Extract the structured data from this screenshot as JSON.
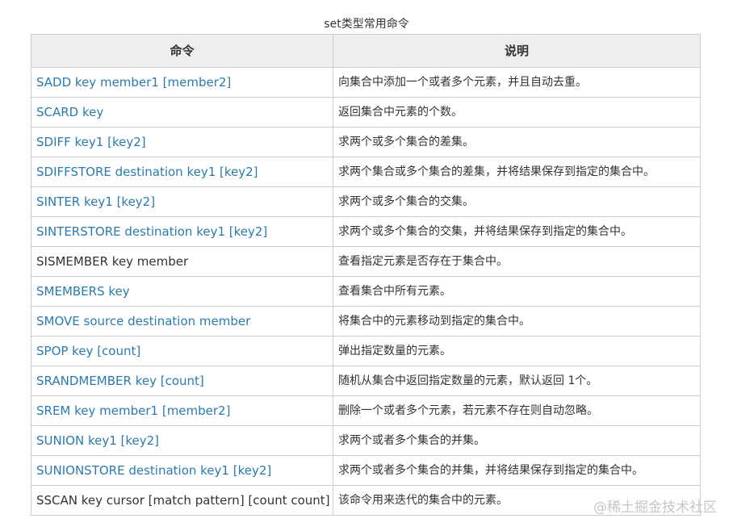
{
  "caption": "set类型常用命令",
  "table": {
    "headers": [
      "命令",
      "说明"
    ],
    "rows": [
      {
        "command": "SADD key member1 [member2]",
        "description": "向集合中添加一个或者多个元素，并且自动去重。",
        "linked": true
      },
      {
        "command": "SCARD key",
        "description": "返回集合中元素的个数。",
        "linked": true
      },
      {
        "command": "SDIFF key1 [key2]",
        "description": "求两个或多个集合的差集。",
        "linked": true
      },
      {
        "command": "SDIFFSTORE destination key1 [key2]",
        "description": "求两个集合或多个集合的差集，并将结果保存到指定的集合中。",
        "linked": true
      },
      {
        "command": "SINTER key1 [key2]",
        "description": "求两个或多个集合的交集。",
        "linked": true
      },
      {
        "command": "SINTERSTORE destination key1 [key2]",
        "description": "求两个或多个集合的交集，并将结果保存到指定的集合中。",
        "linked": true
      },
      {
        "command": "SISMEMBER key member",
        "description": "查看指定元素是否存在于集合中。",
        "linked": false
      },
      {
        "command": "SMEMBERS key",
        "description": "查看集合中所有元素。",
        "linked": true
      },
      {
        "command": "SMOVE source destination member",
        "description": "将集合中的元素移动到指定的集合中。",
        "linked": true
      },
      {
        "command": "SPOP key [count]",
        "description": "弹出指定数量的元素。",
        "linked": true
      },
      {
        "command": "SRANDMEMBER key [count]",
        "description": "随机从集合中返回指定数量的元素，默认返回 1个。",
        "linked": true
      },
      {
        "command": "SREM key member1 [member2]",
        "description": "删除一个或者多个元素，若元素不存在则自动忽略。",
        "linked": true
      },
      {
        "command": "SUNION key1 [key2]",
        "description": "求两个或者多个集合的并集。",
        "linked": true
      },
      {
        "command": "SUNIONSTORE destination key1 [key2]",
        "description": "求两个或者多个集合的并集，并将结果保存到指定的集合中。",
        "linked": true
      },
      {
        "command": "SSCAN key cursor [match pattern] [count count]",
        "description": "该命令用来迭代的集合中的元素。",
        "linked": false
      }
    ]
  },
  "watermark": "@稀土掘金技术社区",
  "colors": {
    "link": "#2a7ab0",
    "header_bg": "#eeeeee",
    "border": "#cccccc",
    "text": "#333333"
  }
}
